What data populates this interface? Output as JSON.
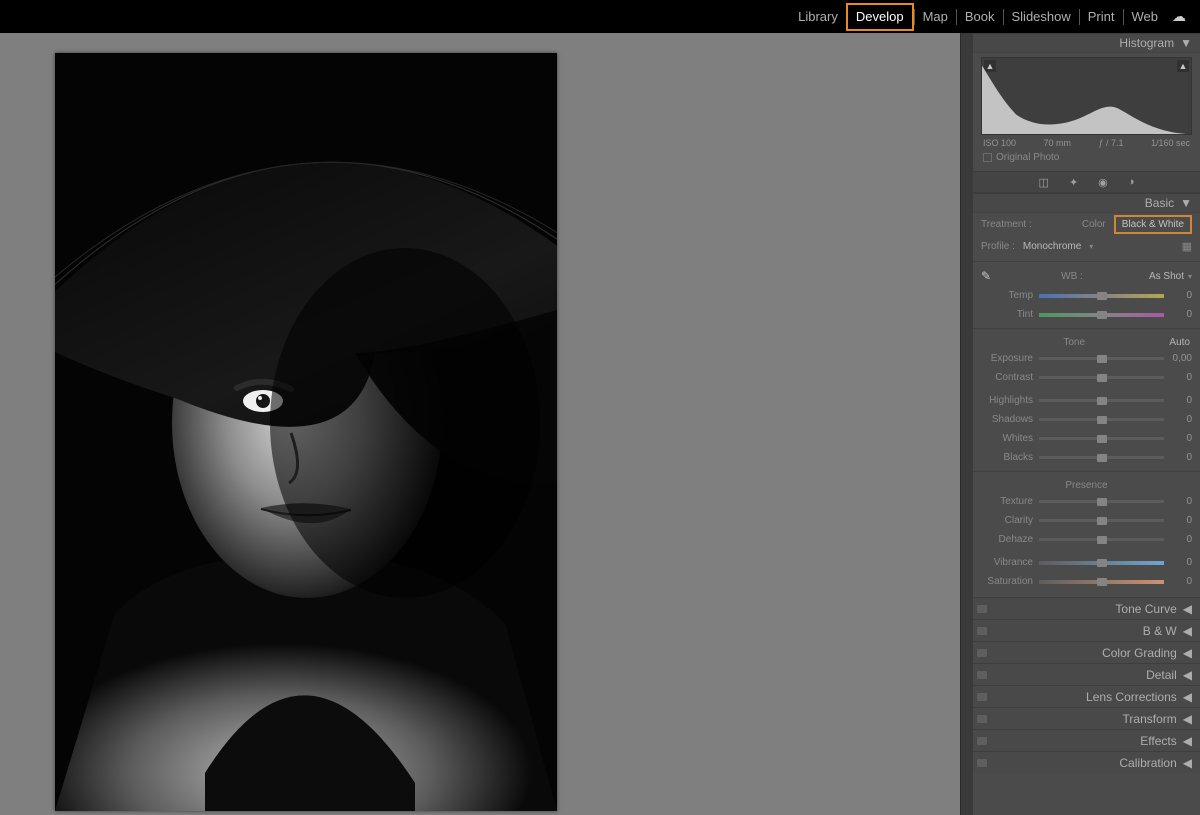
{
  "top_modules": [
    "Library",
    "Develop",
    "Map",
    "Book",
    "Slideshow",
    "Print",
    "Web"
  ],
  "top_active": "Develop",
  "histogram": {
    "title": "Histogram",
    "iso": "ISO 100",
    "focal": "70 mm",
    "aperture": "ƒ / 7.1",
    "shutter": "1/160 sec",
    "original_label": "Original Photo"
  },
  "basic": {
    "title": "Basic",
    "treatment_label": "Treatment :",
    "color_label": "Color",
    "bw_label": "Black & White",
    "profile_label": "Profile :",
    "profile_value": "Monochrome",
    "wb_label": "WB :",
    "wb_value": "As Shot",
    "temp_label": "Temp",
    "temp_value": "0",
    "tint_label": "Tint",
    "tint_value": "0",
    "tone_label": "Tone",
    "auto_label": "Auto",
    "exposure_label": "Exposure",
    "exposure_value": "0,00",
    "contrast_label": "Contrast",
    "contrast_value": "0",
    "highlights_label": "Highlights",
    "highlights_value": "0",
    "shadows_label": "Shadows",
    "shadows_value": "0",
    "whites_label": "Whites",
    "whites_value": "0",
    "blacks_label": "Blacks",
    "blacks_value": "0",
    "presence_label": "Presence",
    "texture_label": "Texture",
    "texture_value": "0",
    "clarity_label": "Clarity",
    "clarity_value": "0",
    "dehaze_label": "Dehaze",
    "dehaze_value": "0",
    "vibrance_label": "Vibrance",
    "vibrance_value": "0",
    "saturation_label": "Saturation",
    "saturation_value": "0"
  },
  "collapsed_panels": [
    "Tone Curve",
    "B & W",
    "Color Grading",
    "Detail",
    "Lens Corrections",
    "Transform",
    "Effects",
    "Calibration"
  ]
}
